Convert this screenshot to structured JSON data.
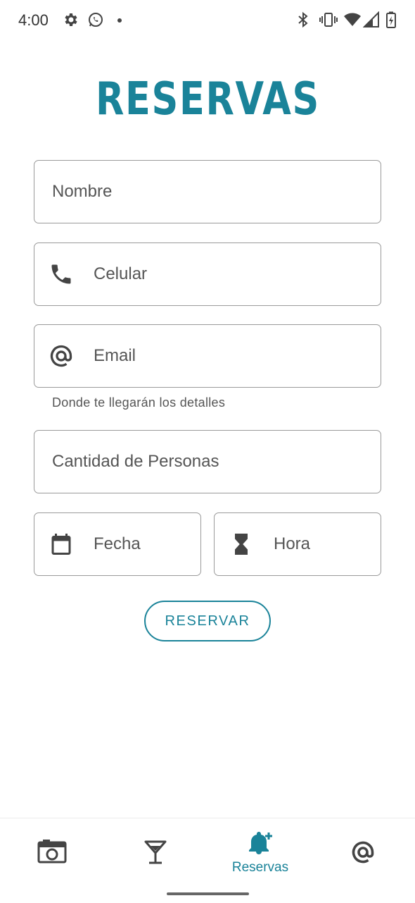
{
  "status_bar": {
    "time": "4:00",
    "icons": [
      "settings-icon",
      "whatsapp-icon",
      "dot-icon",
      "bluetooth-icon",
      "vibrate-icon",
      "wifi-icon",
      "signal-icon",
      "battery-icon"
    ]
  },
  "header": {
    "logo_text": "RESERVAS"
  },
  "form": {
    "name_label": "Nombre",
    "phone_label": "Celular",
    "email_label": "Email",
    "email_helper": "Donde te llegarán los detalles",
    "people_label": "Cantidad de Personas",
    "date_label": "Fecha",
    "time_label": "Hora",
    "submit_label": "RESERVAR"
  },
  "bottom_nav": {
    "items": [
      {
        "icon": "camera-icon",
        "label": ""
      },
      {
        "icon": "cocktail-icon",
        "label": ""
      },
      {
        "icon": "bell-plus-icon",
        "label": "Reservas"
      },
      {
        "icon": "at-icon",
        "label": ""
      }
    ],
    "active_index": 2
  },
  "colors": {
    "accent": "#1a8399",
    "border": "#9a9a9a",
    "icon": "#444444"
  }
}
